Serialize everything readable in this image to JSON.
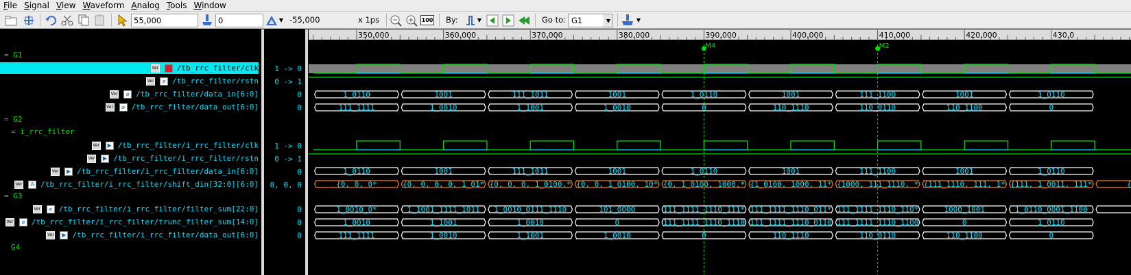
{
  "menubar": {
    "items": [
      "File",
      "Signal",
      "View",
      "Waveform",
      "Analog",
      "Tools",
      "Window"
    ]
  },
  "toolbar": {
    "cursor_time": "55,000",
    "zoom_value": "0",
    "delta_time": "-55,000",
    "time_scale": "x 1ps",
    "by_label": "By:",
    "goto_label": "Go to:",
    "goto_value": "G1",
    "zoom_100_label": "100",
    "icons": [
      "open-icon",
      "add-icon",
      "undo-icon",
      "cut-icon",
      "copy-icon",
      "paste-icon",
      "pointer-icon",
      "probe-icon",
      "delta-icon",
      "zoom-out-icon",
      "zoom-in-icon",
      "zoom-fit-icon",
      "search-edge-icon",
      "prev-icon",
      "next-icon",
      "first-icon",
      "marker-icon"
    ]
  },
  "names_panel": {
    "groups": {
      "g1": "= G1",
      "g2": "= G2",
      "scope": "= i_rrc_filter",
      "g3": "= G3",
      "g4": "G4"
    },
    "signals": [
      "/tb_rrc_filter/clk",
      "/tb_rrc_filter/rstn",
      "/tb_rrc_filter/data_in[6:0]",
      "/tb_rrc_filter/data_out[6:0]",
      "/tb_rrc_filter/i_rrc_filter/clk",
      "/tb_rrc_filter/i_rrc_filter/rstn",
      "/tb_rrc_filter/i_rrc_filter/data_in[6:0]",
      "/tb_rrc_filter/i_rrc_filter/shift_din[32:0][6:0]",
      "/tb_rrc_filter/i_rrc_filter/filter_sum[22:0]",
      "/tb_rrc_filter/i_rrc_filter/trunc_filter_sum[14:0]",
      "/tb_rrc_filter/i_rrc_filter/data_out[6:0]"
    ],
    "badge_text": "Ver"
  },
  "values_panel": {
    "values": [
      "1 -> 0",
      "0 -> 1",
      "0",
      "0",
      "1 -> 0",
      "0 -> 1",
      "0",
      "0, 0, 0",
      "0",
      "0",
      "0"
    ]
  },
  "colors": {
    "grid_green": "#00e000",
    "value_cyan": "#00e0ff",
    "bus_white": "#ffffff",
    "bus_orange": "#ff8000",
    "ruler_bg": "#dcdcdc",
    "selected_row": "#00e8f0"
  },
  "ruler": {
    "labels": [
      "350,000",
      "360,000",
      "370,000",
      "380,000",
      "390,000",
      "400,000",
      "410,000",
      "420,000",
      "430,0"
    ]
  },
  "markers": [
    {
      "name": "M4",
      "time": 390000
    },
    {
      "name": "M2",
      "time": 410000
    }
  ],
  "buses": {
    "data_in": [
      "1_0110",
      "1001",
      "111_1011",
      "1001",
      "1_0110",
      "1001",
      "111_1100",
      "1001",
      "1_0110"
    ],
    "data_out": [
      "111_1111",
      "1_0010",
      "1_1001",
      "1_0010",
      "0",
      "110_1110",
      "110_0110",
      "110_1100",
      "0"
    ],
    "shift_din": [
      "{0, 0, 0*",
      "{0, 0, 0, 0, 1_01*",
      "{0, 0, 0, 1_0100,*",
      "{0, 0, 1_0100, 10*",
      "{0, 1_0100, 1000,*",
      "{1_0100, 1000, 11*",
      "{1000, 111_1110, *",
      "{111_1110, 111, 1*",
      "{111, 1_0011, 111*",
      "{1_00"
    ],
    "filter_sum": [
      "1_0010_0*",
      "1_1001_1111_1011",
      "1_0010_0111_1110",
      "101_0000",
      "111_1111_1110_111*",
      "111_1111_1110_011*",
      "111_1111_1110_110*",
      "1000_1001",
      "1_0110_0001_1100",
      "1_0"
    ],
    "trunc_filter_sum": [
      "1_0010",
      "1_1001",
      "1_0010",
      "0",
      "111_1111_1110_1110",
      "111_1111_1110_0110",
      "111_1111_1110_1100",
      "0",
      "1_0110"
    ],
    "data_out_i": [
      "111_1111",
      "1_0010",
      "1_1001",
      "1_0010",
      "0",
      "110_1110",
      "110_0110",
      "110_1100",
      "0"
    ]
  }
}
